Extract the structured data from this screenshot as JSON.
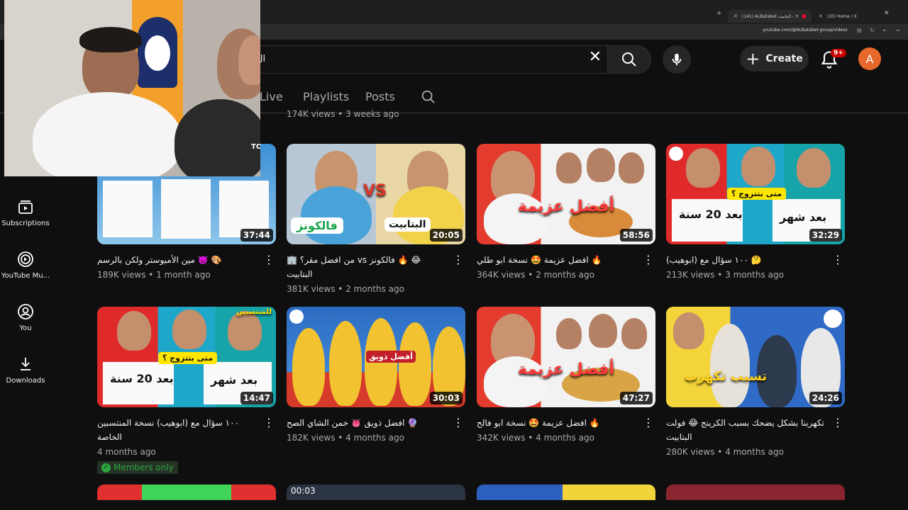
{
  "browser": {
    "tabs": [
      {
        "label": "(141) ALBatabet البتابيت - You",
        "active": true
      },
      {
        "label": "(20) Home / X",
        "active": false
      }
    ],
    "new_tab": "+",
    "close_glyph": "✕",
    "x_glyph": "✕",
    "url": "youtube.com/@ALBatabet-group/videos"
  },
  "header": {
    "search_value": "ال",
    "create_label": "Create",
    "notification_count": "9+",
    "avatar_letter": "A"
  },
  "channel_tabs": [
    {
      "label": "Live"
    },
    {
      "label": "Playlists"
    },
    {
      "label": "Posts"
    }
  ],
  "sidebar": {
    "items": [
      {
        "label": "Subscriptions",
        "icon": "subscriptions-icon"
      },
      {
        "label": "YouTube Mu...",
        "icon": "youtube-music-icon"
      },
      {
        "label": "You",
        "icon": "you-icon"
      },
      {
        "label": "Downloads",
        "icon": "downloads-icon"
      }
    ]
  },
  "partial_meta": "174K views • 3 weeks ago",
  "videos": [
    {
      "title": "🎨 👿 مين الأميوستر ولكن بالرسم",
      "views": "189K views",
      "age": "1 month ago",
      "duration": "37:44"
    },
    {
      "title": "😂 🔥 فالكونز vs من افضل مقر؟ 🏢 البتابيت",
      "views": "381K views",
      "age": "2 months ago",
      "duration": "20:05",
      "thumb_left": "فالكونز",
      "thumb_right": "البتابيت",
      "thumb_vs": "VS"
    },
    {
      "title": "🔥 افضل عزيمة 🤩 نسخة ابو طلي",
      "views": "364K views",
      "age": "2 months ago",
      "duration": "58:56",
      "thumb_text": "أفضل عزيمة"
    },
    {
      "title": "🤔 ١٠٠ سؤال مع (ابوهيب)",
      "views": "213K views",
      "age": "3 months ago",
      "duration": "32:29",
      "thumb_left": "بعد 20 سنة",
      "thumb_right": "بعد شهر",
      "thumb_q": "متى بتتزوج ؟"
    },
    {
      "title": "١٠٠ سؤال مع (ابوهيب) نسخة المنتسبين الخاصة",
      "views": "",
      "age": "4 months ago",
      "duration": "14:47",
      "members": "Members only",
      "thumb_left": "بعد 20 سنة",
      "thumb_right": "بعد شهر",
      "thumb_q": "متى بتتزوج ؟",
      "thumb_corner": "للمنتسبين"
    },
    {
      "title": "🔮 افضل ذويق 👅 خمن الشاي الصح",
      "views": "182K views",
      "age": "4 months ago",
      "duration": "30:03",
      "thumb_text": "أفضل ذويق"
    },
    {
      "title": "🔥 افضل عزيمة 🤩 نسخة ابو فالح",
      "views": "342K views",
      "age": "4 months ago",
      "duration": "47:27",
      "thumb_text": "أفضل عزيمة"
    },
    {
      "title": "تكهربنا بشكل يضحك بسبب الكرينج 😂 فولت البتابيت",
      "views": "280K views",
      "age": "4 months ago",
      "duration": "24:26",
      "thumb_text": "تسبب تكهرب"
    }
  ],
  "bottom_row": [
    {
      "duration": ""
    },
    {
      "duration": "00:03"
    },
    {
      "duration": ""
    },
    {
      "duration": ""
    }
  ],
  "webcam_badge": "TO"
}
